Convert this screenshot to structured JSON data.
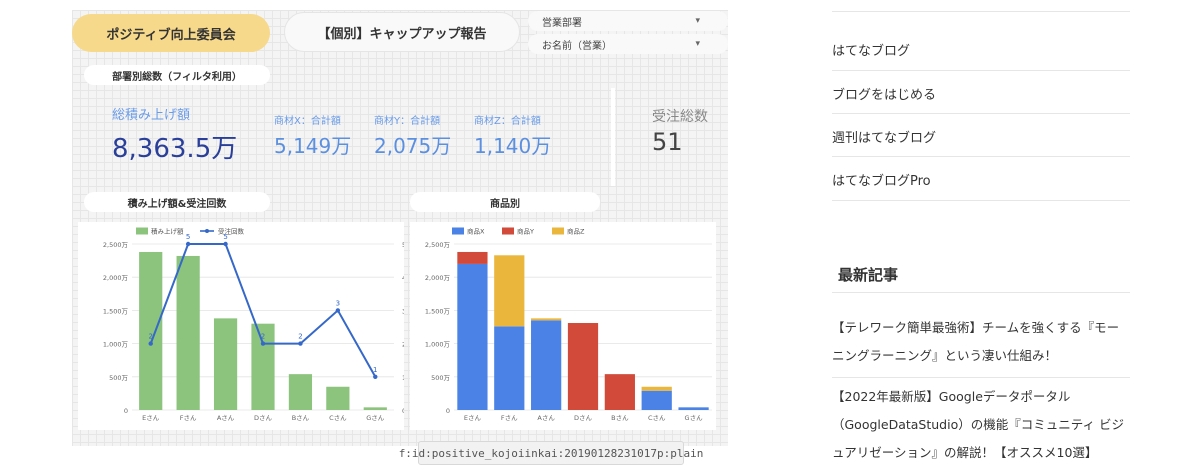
{
  "dashboard": {
    "title_pill": "ポジティブ向上委員会",
    "report_title": "【個別】キャップアップ報告",
    "filters": [
      {
        "label": "営業部署",
        "caret": "▾"
      },
      {
        "label": "お名前（営業）",
        "caret": "▾"
      }
    ],
    "section_totals": "部署別総数（フィルタ利用）",
    "kpi": {
      "total_label": "総積み上げ額",
      "total_value": "8,363.5万",
      "x_label": "商材X：合計額",
      "x_value": "5,149万",
      "y_label": "商材Y：合計額",
      "y_value": "2,075万",
      "z_label": "商材Z：合計額",
      "z_value": "1,140万",
      "orders_label": "受注総数",
      "orders_value": "51"
    },
    "section_chart1": "積み上げ額&受注回数",
    "section_chart2": "商品別"
  },
  "chart_data": [
    {
      "type": "bar",
      "categories": [
        "Eさん",
        "Fさん",
        "Aさん",
        "Dさん",
        "Bさん",
        "Cさん",
        "Gさん"
      ],
      "series": [
        {
          "name": "積み上げ額",
          "type": "bar",
          "color": "#8cc47e",
          "values": [
            2380,
            2320,
            1380,
            1300,
            540,
            350,
            40
          ]
        },
        {
          "name": "受注回数",
          "type": "line",
          "color": "#3568c8",
          "values": [
            2,
            5,
            5,
            2,
            2,
            3,
            1
          ]
        }
      ],
      "y_ticks": [
        "0",
        "500万",
        "1,000万",
        "1,500万",
        "2,000万",
        "2,500万"
      ],
      "y2_ticks": [
        "0",
        "1",
        "2",
        "3",
        "4",
        "5"
      ],
      "line_labels": [
        "2",
        "5",
        "5",
        "2",
        "2",
        "3",
        "1"
      ],
      "ylim": [
        0,
        2500
      ],
      "y2lim": [
        0,
        5
      ],
      "legend": "top-left"
    },
    {
      "type": "bar",
      "stacked": true,
      "categories": [
        "Eさん",
        "Fさん",
        "Aさん",
        "Dさん",
        "Bさん",
        "Cさん",
        "Gさん"
      ],
      "series": [
        {
          "name": "商品X",
          "color": "#4a82e6",
          "values": [
            2200,
            1260,
            1350,
            0,
            0,
            290,
            40
          ]
        },
        {
          "name": "商品Y",
          "color": "#d24a3a",
          "values": [
            180,
            0,
            0,
            1310,
            540,
            0,
            0
          ]
        },
        {
          "name": "商品Z",
          "color": "#eab63c",
          "values": [
            0,
            1070,
            30,
            0,
            0,
            60,
            0
          ]
        }
      ],
      "y_ticks": [
        "0",
        "500万",
        "1,000万",
        "1,500万",
        "2,000万",
        "2,500万"
      ],
      "ylim": [
        0,
        2500
      ],
      "legend": "top-left"
    }
  ],
  "caption": "f:id:positive_kojoiinkai:20190128231017p:plain",
  "sidebar": {
    "links": [
      "はてなブログ",
      "ブログをはじめる",
      "週刊はてなブログ",
      "はてなブログPro"
    ],
    "recent_heading": "最新記事",
    "articles": [
      "【テレワーク簡単最強術】チームを強くする『モーニングラーニング』という凄い仕組み！",
      "【2022年最新版】Googleデータポータル（GoogleDataStudio）の機能『コミュニティ ビジュアリゼーション』の解説！【オススメ10選】"
    ]
  }
}
